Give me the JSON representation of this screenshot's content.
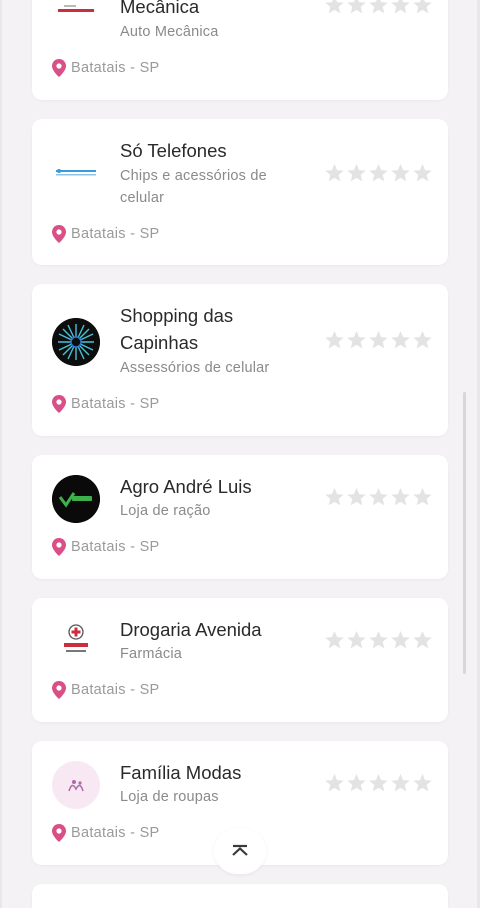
{
  "colors": {
    "accent_pink": "#d94f87",
    "star_gray": "#e3e3e3",
    "background": "#f4f2f4"
  },
  "icons": {
    "location": "map-pin-icon",
    "rating": "star-icon",
    "back_to_top": "chevron-up-icon"
  },
  "businesses": [
    {
      "name": "Mecânica",
      "category": "Auto Mecânica",
      "location": "Batatais - SP",
      "rating": 0,
      "logo": "mecanica-logo"
    },
    {
      "name": "Só Telefones",
      "category": "Chips e acessórios de celular",
      "location": "Batatais - SP",
      "rating": 0,
      "logo": "so-telefones-logo"
    },
    {
      "name": "Shopping das Capinhas",
      "category": "Assessórios de celular",
      "location": "Batatais - SP",
      "rating": 0,
      "logo": "shopping-das-capinhas-logo"
    },
    {
      "name": "Agro André Luis",
      "category": "Loja de ração",
      "location": "Batatais - SP",
      "rating": 0,
      "logo": "agro-andre-luis-logo"
    },
    {
      "name": "Drogaria Avenida",
      "category": "Farmácia",
      "location": "Batatais - SP",
      "rating": 0,
      "logo": "drogaria-avenida-logo"
    },
    {
      "name": "Família Modas",
      "category": "Loja de roupas",
      "location": "Batatais - SP",
      "rating": 0,
      "logo": "familia-modas-logo"
    }
  ]
}
